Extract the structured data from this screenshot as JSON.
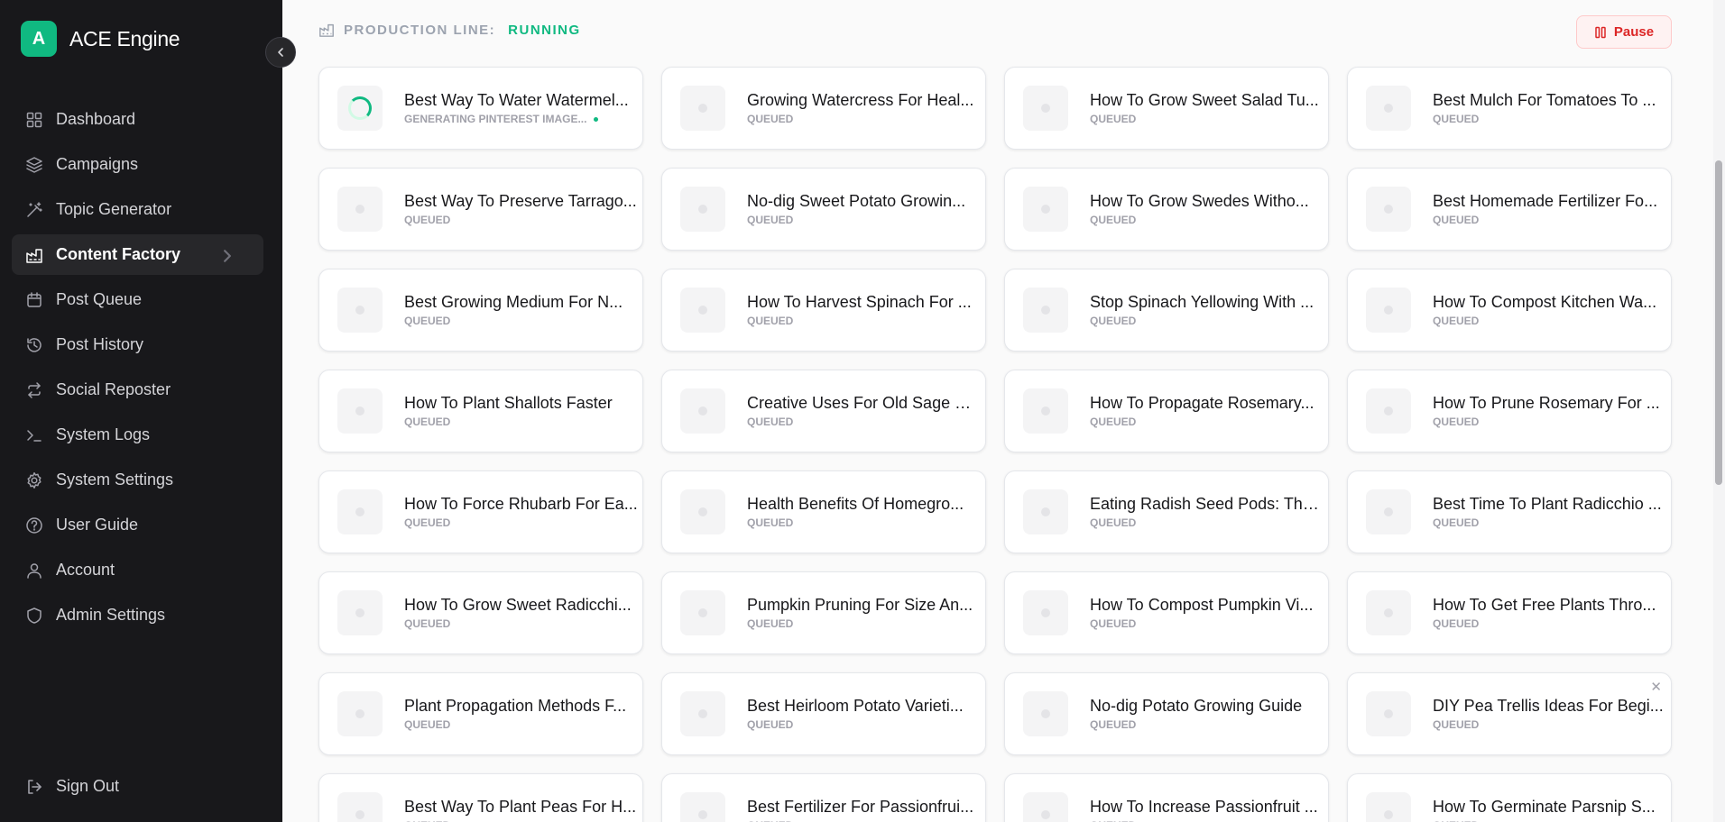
{
  "app": {
    "logo_letter": "A",
    "name": "ACE Engine"
  },
  "sidebar": {
    "items": [
      {
        "label": "Dashboard",
        "icon": "dashboard-icon"
      },
      {
        "label": "Campaigns",
        "icon": "layers-icon"
      },
      {
        "label": "Topic Generator",
        "icon": "wand-icon"
      },
      {
        "label": "Content Factory",
        "icon": "factory-icon",
        "active": true
      },
      {
        "label": "Post Queue",
        "icon": "calendar-icon"
      },
      {
        "label": "Post History",
        "icon": "history-icon"
      },
      {
        "label": "Social Reposter",
        "icon": "repeat-icon"
      },
      {
        "label": "System Logs",
        "icon": "terminal-icon"
      },
      {
        "label": "System Settings",
        "icon": "gear-icon"
      },
      {
        "label": "User Guide",
        "icon": "help-icon"
      },
      {
        "label": "Account",
        "icon": "user-icon"
      },
      {
        "label": "Admin Settings",
        "icon": "shield-icon"
      }
    ],
    "signout_label": "Sign Out"
  },
  "production": {
    "label": "PRODUCTION LINE:",
    "status": "RUNNING",
    "pause_label": "Pause"
  },
  "colors": {
    "accent": "#10b981",
    "danger": "#dc2626",
    "sidebar_bg": "#18181b"
  },
  "cards": [
    {
      "title": "Best Way To Water Watermel...",
      "status": "GENERATING PINTEREST IMAGE...",
      "active": true
    },
    {
      "title": "Growing Watercress For Heal...",
      "status": "QUEUED"
    },
    {
      "title": "How To Grow Sweet Salad Tu...",
      "status": "QUEUED"
    },
    {
      "title": "Best Mulch For Tomatoes To ...",
      "status": "QUEUED"
    },
    {
      "title": "Best Way To Preserve Tarrago...",
      "status": "QUEUED"
    },
    {
      "title": "No-dig Sweet Potato Growin...",
      "status": "QUEUED"
    },
    {
      "title": "How To Grow Swedes Witho...",
      "status": "QUEUED"
    },
    {
      "title": "Best Homemade Fertilizer Fo...",
      "status": "QUEUED"
    },
    {
      "title": "Best Growing Medium For N...",
      "status": "QUEUED"
    },
    {
      "title": "How To Harvest Spinach For ...",
      "status": "QUEUED"
    },
    {
      "title": "Stop Spinach Yellowing With ...",
      "status": "QUEUED"
    },
    {
      "title": "How To Compost Kitchen Wa...",
      "status": "QUEUED"
    },
    {
      "title": "How To Plant Shallots Faster",
      "status": "QUEUED"
    },
    {
      "title": "Creative Uses For Old Sage St...",
      "status": "QUEUED"
    },
    {
      "title": "How To Propagate Rosemary...",
      "status": "QUEUED"
    },
    {
      "title": "How To Prune Rosemary For ...",
      "status": "QUEUED"
    },
    {
      "title": "How To Force Rhubarb For Ea...",
      "status": "QUEUED"
    },
    {
      "title": "Health Benefits Of Homegro...",
      "status": "QUEUED"
    },
    {
      "title": "Eating Radish Seed Pods: The...",
      "status": "QUEUED"
    },
    {
      "title": "Best Time To Plant Radicchio ...",
      "status": "QUEUED"
    },
    {
      "title": "How To Grow Sweet Radicchi...",
      "status": "QUEUED"
    },
    {
      "title": "Pumpkin Pruning For Size An...",
      "status": "QUEUED"
    },
    {
      "title": "How To Compost Pumpkin Vi...",
      "status": "QUEUED"
    },
    {
      "title": "How To Get Free Plants Thro...",
      "status": "QUEUED"
    },
    {
      "title": "Plant Propagation Methods F...",
      "status": "QUEUED"
    },
    {
      "title": "Best Heirloom Potato Varieti...",
      "status": "QUEUED"
    },
    {
      "title": "No-dig Potato Growing Guide",
      "status": "QUEUED"
    },
    {
      "title": "DIY Pea Trellis Ideas For Begi...",
      "status": "QUEUED",
      "close": "✕"
    },
    {
      "title": "Best Way To Plant Peas For H...",
      "status": "QUEUED"
    },
    {
      "title": "Best Fertilizer For Passionfrui...",
      "status": "QUEUED"
    },
    {
      "title": "How To Increase Passionfruit ...",
      "status": "QUEUED"
    },
    {
      "title": "How To Germinate Parsnip S...",
      "status": "QUEUED"
    }
  ]
}
